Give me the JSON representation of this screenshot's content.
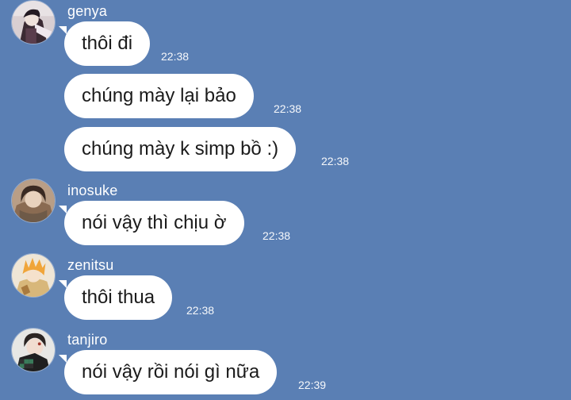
{
  "theme": {
    "background": "#5a7fb4",
    "bubble_color": "#ffffff",
    "text_color": "#1b1b1b"
  },
  "messages": [
    {
      "sender": "genya",
      "text": "thôi đi",
      "time": "22:38"
    },
    {
      "sender": "",
      "text": "chúng mày lại bảo",
      "time": "22:38"
    },
    {
      "sender": "",
      "text": "chúng mày k simp bồ :)",
      "time": "22:38"
    },
    {
      "sender": "inosuke",
      "text": "nói vậy thì chịu ờ",
      "time": "22:38"
    },
    {
      "sender": "zenitsu",
      "text": "thôi thua",
      "time": "22:38"
    },
    {
      "sender": "tanjiro",
      "text": "nói vậy rồi nói gì nữa",
      "time": "22:39"
    }
  ],
  "avatars": [
    {
      "user": "genya",
      "icon": "genya-avatar"
    },
    {
      "user": "inosuke",
      "icon": "inosuke-avatar"
    },
    {
      "user": "zenitsu",
      "icon": "zenitsu-avatar"
    },
    {
      "user": "tanjiro",
      "icon": "tanjiro-avatar"
    }
  ]
}
